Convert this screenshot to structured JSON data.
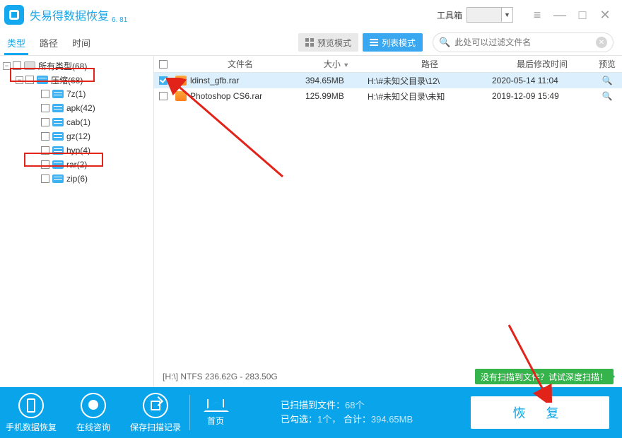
{
  "app": {
    "title": "失易得数据恢复",
    "version": "6. 81",
    "toolbox": "工具箱"
  },
  "tabs": {
    "type": "类型",
    "path": "路径",
    "time": "时间"
  },
  "mode": {
    "preview": "预览模式",
    "list": "列表模式"
  },
  "search": {
    "placeholder": "此处可以过滤文件名"
  },
  "tree": {
    "all": "所有类型(68)",
    "archive": "压缩(68)",
    "children": {
      "z7": "7z(1)",
      "apk": "apk(42)",
      "cab": "cab(1)",
      "gz": "gz(12)",
      "hyp": "hyp(4)",
      "rar": "rar(2)",
      "zip": "zip(6)"
    }
  },
  "cols": {
    "name": "文件名",
    "size": "大小",
    "path": "路径",
    "date": "最后修改时间",
    "preview": "预览"
  },
  "files": [
    {
      "name": "ldinst_gfb.rar",
      "size": "394.65MB",
      "path": "H:\\#未知父目录\\12\\",
      "date": "2020-05-14  11:04"
    },
    {
      "name": "Photoshop CS6.rar",
      "size": "125.99MB",
      "path": "H:\\#未知父目录\\未知",
      "date": "2019-12-09  15:49"
    }
  ],
  "disk": "[H:\\] NTFS 236.62G - 283.50G",
  "deepscan": "没有扫描到文件？试试深度扫描！",
  "footer": {
    "phone": "手机数据恢复",
    "chat": "在线咨询",
    "save": "保存扫描记录",
    "home": "首页",
    "scanned_label": "已扫描到文件：",
    "scanned_count": "68个",
    "checked_label": "已勾选：",
    "checked_count": "1个，",
    "total_label": "合计：",
    "total_size": "394.65MB",
    "recover": "恢 复"
  }
}
